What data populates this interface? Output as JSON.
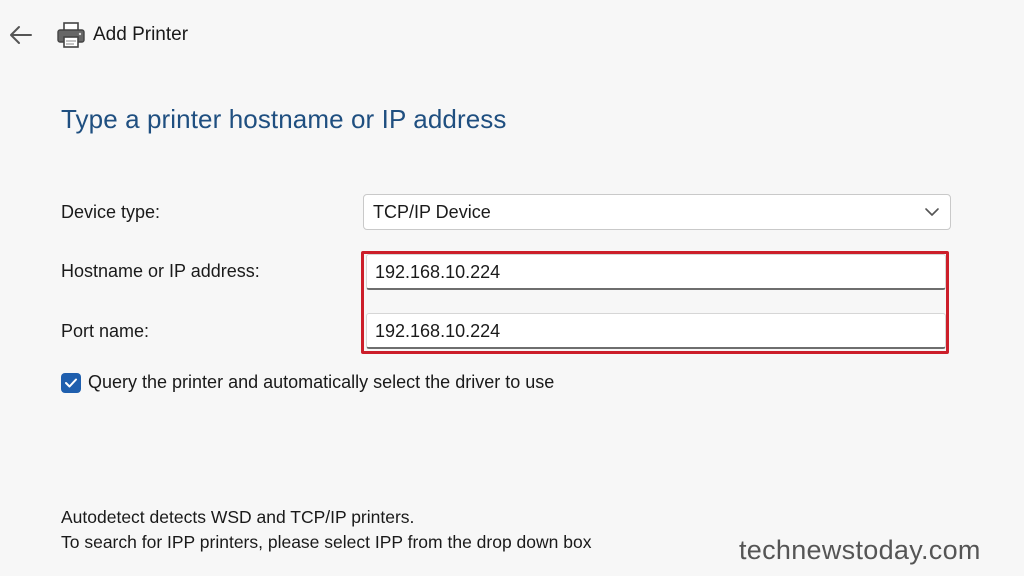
{
  "window": {
    "title": "Add Printer"
  },
  "page": {
    "heading": "Type a printer hostname or IP address"
  },
  "form": {
    "device_type_label": "Device type:",
    "device_type_value": "TCP/IP Device",
    "hostname_label": "Hostname or IP address:",
    "hostname_value": "192.168.10.224",
    "port_label": "Port name:",
    "port_value": "192.168.10.224",
    "query_checkbox_label": "Query the printer and automatically select the driver to use",
    "query_checkbox_checked": true
  },
  "info": {
    "line1": "Autodetect detects WSD and TCP/IP printers.",
    "line2": "To search for IPP printers, please select IPP from the drop down box"
  },
  "watermark": {
    "text": "technewstoday.com"
  },
  "colors": {
    "heading": "#1f4f80",
    "highlight_border": "#cc1e2a",
    "checkbox_fill": "#1f5fae",
    "background": "#f7f7f7"
  },
  "icons": {
    "back": "arrow-left-icon",
    "printer": "printer-icon",
    "dropdown": "chevron-down-icon",
    "checkmark": "checkmark-icon"
  }
}
